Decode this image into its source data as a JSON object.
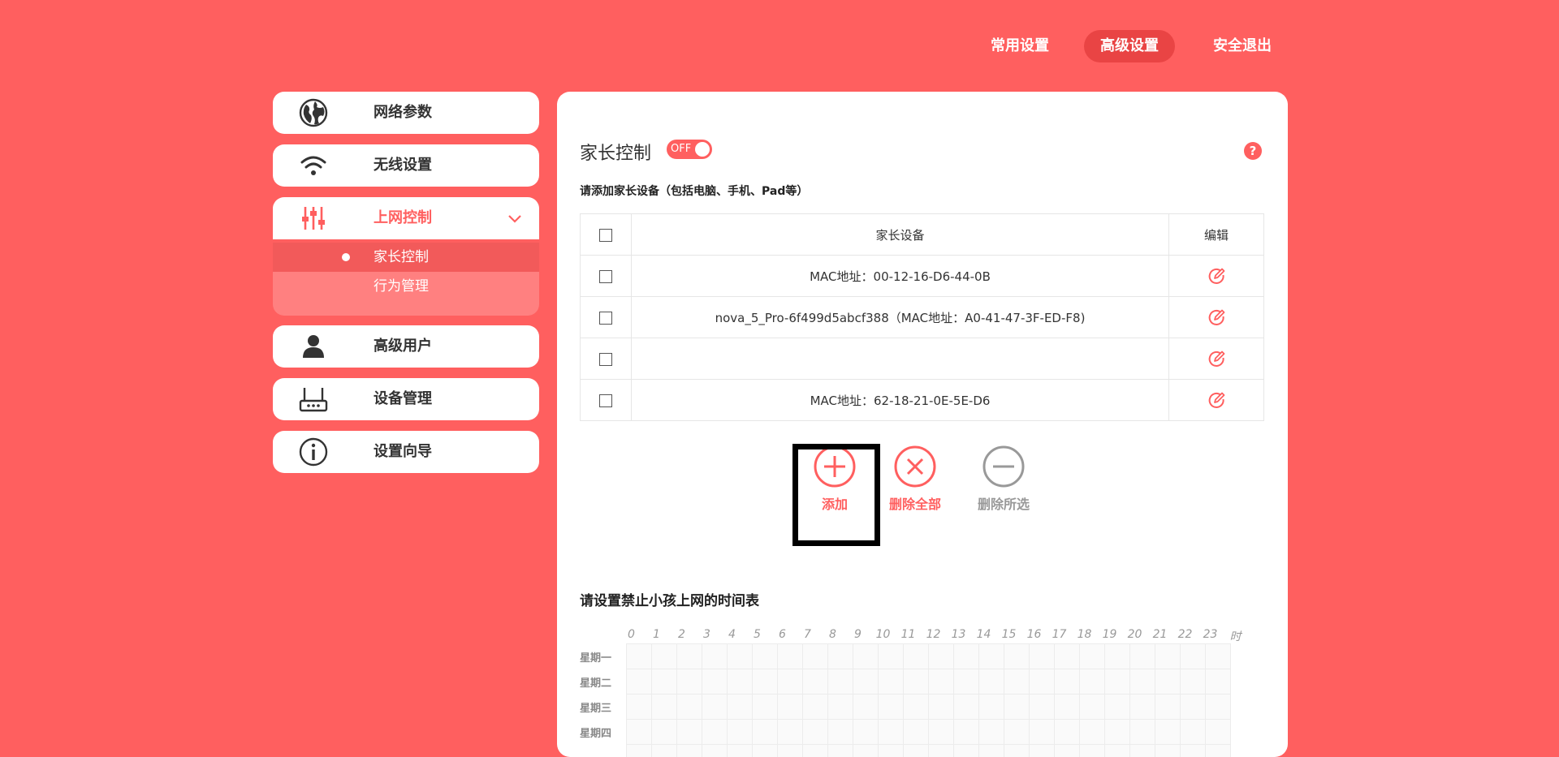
{
  "topnav": {
    "common": "常用设置",
    "advanced": "高级设置",
    "exit": "安全退出"
  },
  "sidebar": {
    "items": [
      {
        "label": "网络参数",
        "icon": "globe-icon"
      },
      {
        "label": "无线设置",
        "icon": "wifi-icon"
      },
      {
        "label": "上网控制",
        "icon": "sliders-icon",
        "active": true
      },
      {
        "label": "高级用户",
        "icon": "user-icon"
      },
      {
        "label": "设备管理",
        "icon": "router-icon"
      },
      {
        "label": "设置向导",
        "icon": "info-icon"
      }
    ],
    "submenu": [
      {
        "label": "家长控制",
        "active": true
      },
      {
        "label": "行为管理"
      }
    ]
  },
  "panel": {
    "title": "家长控制",
    "toggle_label": "OFF",
    "help": "?",
    "subtitle": "请添加家长设备（包括电脑、手机、Pad等）",
    "table": {
      "header_device": "家长设备",
      "header_edit": "编辑",
      "rows": [
        "MAC地址：00-12-16-D6-44-0B",
        "nova_5_Pro-6f499d5abcf388（MAC地址：A0-41-47-3F-ED-F8)",
        "",
        "MAC地址：62-18-21-0E-5E-D6"
      ]
    },
    "actions": {
      "add": "添加",
      "delete_all": "删除全部",
      "delete_selected": "删除所选"
    },
    "schedule": {
      "title": "请设置禁止小孩上网的时间表",
      "hours": [
        "0",
        "1",
        "2",
        "3",
        "4",
        "5",
        "6",
        "7",
        "8",
        "9",
        "10",
        "11",
        "12",
        "13",
        "14",
        "15",
        "16",
        "17",
        "18",
        "19",
        "20",
        "21",
        "22",
        "23",
        "时"
      ],
      "days": [
        "星期一",
        "星期二",
        "星期三",
        "星期四"
      ]
    }
  },
  "colors": {
    "accent": "#ff5f5f",
    "accent_dark": "#e94444",
    "submenu_bg": "#ff8080",
    "disabled_gray": "#999999"
  }
}
